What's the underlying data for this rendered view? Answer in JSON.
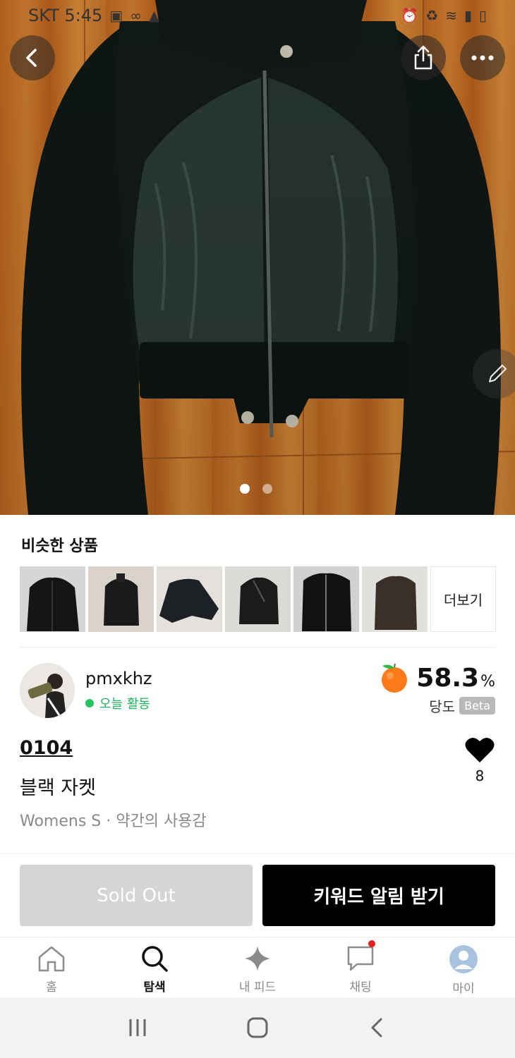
{
  "status_bar": {
    "carrier_time": "SKT 5:45",
    "left_icons": [
      "gallery-icon",
      "voicemail-icon",
      "warning-icon"
    ],
    "right_icons": [
      "alarm-icon",
      "battery-saver-icon",
      "wifi-icon",
      "signal-icon",
      "battery-icon"
    ]
  },
  "hero": {
    "image_count": 2,
    "active_index": 0
  },
  "similar": {
    "title": "비슷한 상품",
    "more_label": "더보기",
    "thumbnail_count": 6
  },
  "seller": {
    "name": "pmxkhz",
    "activity": "오늘 활동",
    "score": "58.3",
    "score_unit": "%",
    "score_label": "당도",
    "beta_label": "Beta"
  },
  "product": {
    "code": "0104",
    "name": "블랙 자켓",
    "meta": "Womens S · 약간의 사용감",
    "likes": "8"
  },
  "actions": {
    "sold_out_label": "Sold Out",
    "keyword_alert_label": "키워드 알림 받기"
  },
  "tabs": [
    {
      "label": "홈",
      "icon": "home-icon",
      "active": false
    },
    {
      "label": "탐색",
      "icon": "search-icon",
      "active": true
    },
    {
      "label": "내 피드",
      "icon": "sparkle-icon",
      "active": false
    },
    {
      "label": "채팅",
      "icon": "chat-icon",
      "active": false
    },
    {
      "label": "마이",
      "icon": "profile-icon",
      "active": false
    }
  ],
  "colors": {
    "accent_green": "#22c55e",
    "sold_out_gray": "#d5d5d5",
    "primary_black": "#000000",
    "notification_red": "#e51f1f"
  }
}
